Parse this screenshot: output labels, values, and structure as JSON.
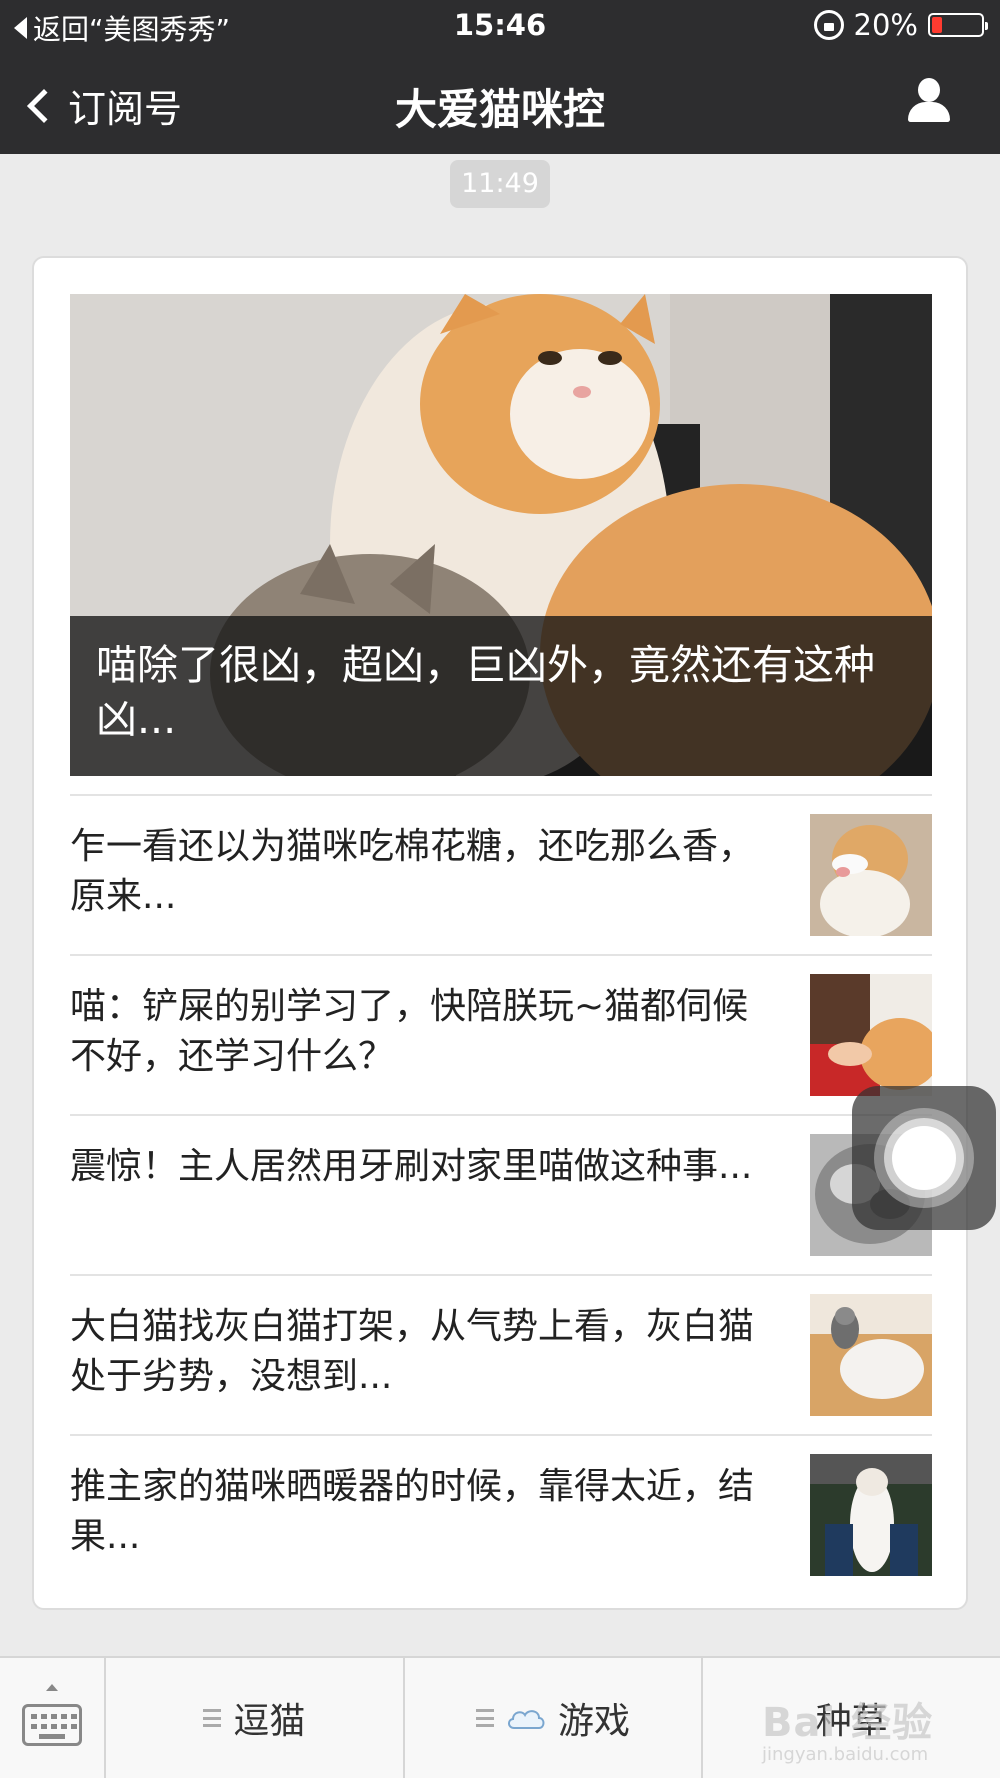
{
  "status_bar": {
    "back_app": "返回“美图秀秀”",
    "time": "15:46",
    "battery": "20%",
    "battery_level": 0.2,
    "battery_color": "#ff3b30"
  },
  "nav": {
    "back_label": "订阅号",
    "title": "大爱猫咪控",
    "profile_icon": "person-icon"
  },
  "timestamp": "11:49",
  "hero": {
    "caption": "喵除了很凶，超凶，巨凶外，竟然还有这种凶..."
  },
  "articles": [
    {
      "title": "乍一看还以为猫咪吃棉花糖，还吃那么香，原来..."
    },
    {
      "title": "喵：铲屎的别学习了，快陪朕玩~猫都伺候不好，还学习什么？"
    },
    {
      "title": "震惊！主人居然用牙刷对家里喵做这种事..."
    },
    {
      "title": "大白猫找灰白猫打架，从气势上看，灰白猫处于劣势，没想到..."
    },
    {
      "title": "推主家的猫咪晒暖器的时候，靠得太近，结果..."
    }
  ],
  "menu": {
    "keyboard_icon": "keyboard-icon",
    "items": [
      {
        "label": "逗猫",
        "icon": "menu-lines-icon"
      },
      {
        "label": "游戏",
        "icon": "cloud-icon"
      },
      {
        "label": "种草",
        "icon": ""
      }
    ]
  },
  "watermark": {
    "main": "Bai 经验",
    "sub": "jingyan.baidu.com"
  }
}
